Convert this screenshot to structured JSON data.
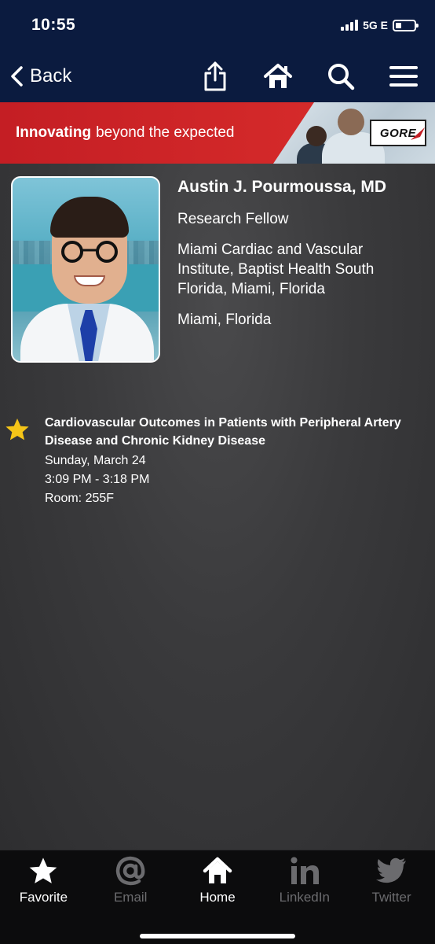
{
  "status_bar": {
    "time": "10:55",
    "network": "5G E",
    "battery_level": 0.3
  },
  "nav": {
    "back_label": "Back",
    "icons": [
      "share-icon",
      "home-icon",
      "search-icon",
      "menu-icon"
    ]
  },
  "banner": {
    "text_bold": "Innovating",
    "text_regular": "beyond the expected",
    "logo": "GORE",
    "colors": {
      "red": "#c41e24"
    }
  },
  "speaker": {
    "name": "Austin J. Pourmoussa, MD",
    "title": "Research Fellow",
    "institution": "Miami Cardiac and Vascular Institute, Baptist Health South Florida, Miami, Florida",
    "location": "Miami, Florida"
  },
  "session": {
    "favorited": true,
    "title": "Cardiovascular Outcomes in Patients with Peripheral Artery Disease and Chronic Kidney Disease",
    "date": "Sunday, March 24",
    "time": "3:09 PM - 3:18 PM",
    "room": "Room: 255F",
    "star_color": "#f5c518"
  },
  "tab_bar": {
    "tabs": [
      {
        "label": "Favorite",
        "icon": "star-icon",
        "active": true
      },
      {
        "label": "Email",
        "icon": "at-icon",
        "active": false
      },
      {
        "label": "Home",
        "icon": "home-icon",
        "active": true
      },
      {
        "label": "LinkedIn",
        "icon": "linkedin-icon",
        "active": false
      },
      {
        "label": "Twitter",
        "icon": "twitter-icon",
        "active": false
      }
    ]
  },
  "colors": {
    "nav_background": "#0b1b3f",
    "content_background": "#3a3a3c",
    "tab_bar_background": "#0c0c0d"
  }
}
